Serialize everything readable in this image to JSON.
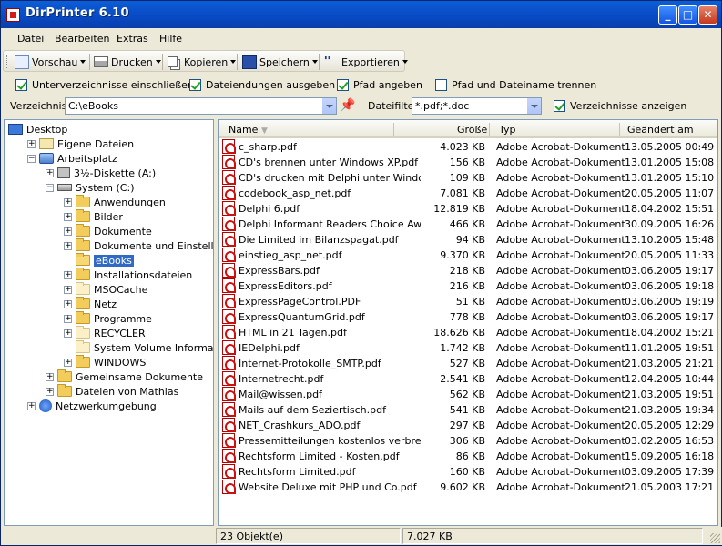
{
  "window": {
    "title": "DirPrinter 6.10",
    "min": "_",
    "max": "□",
    "close": "✕"
  },
  "menu": [
    "Datei",
    "Bearbeiten",
    "Extras",
    "Hilfe"
  ],
  "toolbar": {
    "preview": "Vorschau",
    "print": "Drucken",
    "copy": "Kopieren",
    "save": "Speichern",
    "export": "Exportieren"
  },
  "options": {
    "include_subdirs": {
      "label": "Unterverzeichnisse einschließen",
      "checked": true
    },
    "show_extensions": {
      "label": "Dateiendungen ausgeben",
      "checked": true
    },
    "show_path": {
      "label": "Pfad angeben",
      "checked": true
    },
    "split_path": {
      "label": "Pfad und Dateiname trennen",
      "checked": false
    },
    "show_dirs": {
      "label": "Verzeichnisse anzeigen",
      "checked": true
    }
  },
  "directory": {
    "label": "Verzeichnis",
    "value": "C:\\eBooks"
  },
  "filter": {
    "label": "Dateifilter",
    "value": "*.pdf;*.doc"
  },
  "tree": [
    {
      "label": "Desktop",
      "level": 0,
      "icon": "desktop-icon",
      "box": ""
    },
    {
      "label": "Eigene Dateien",
      "level": 1,
      "icon": "my-documents-icon",
      "box": "+"
    },
    {
      "label": "Arbeitsplatz",
      "level": 1,
      "icon": "my-computer-icon",
      "box": "−"
    },
    {
      "label": "3½-Diskette (A:)",
      "level": 2,
      "icon": "floppy-icon",
      "box": "+"
    },
    {
      "label": "System (C:)",
      "level": 2,
      "icon": "drive-icon",
      "box": "−"
    },
    {
      "label": "Anwendungen",
      "level": 3,
      "icon": "folder-icon",
      "box": "+"
    },
    {
      "label": "Bilder",
      "level": 3,
      "icon": "folder-icon",
      "box": "+"
    },
    {
      "label": "Dokumente",
      "level": 3,
      "icon": "folder-icon",
      "box": "+"
    },
    {
      "label": "Dokumente und Einstellungen",
      "level": 3,
      "icon": "folder-icon",
      "box": "+"
    },
    {
      "label": "eBooks",
      "level": 3,
      "icon": "folder-open-icon",
      "box": "",
      "selected": true
    },
    {
      "label": "Installationsdateien",
      "level": 3,
      "icon": "folder-icon",
      "box": "+"
    },
    {
      "label": "MSOCache",
      "level": 3,
      "icon": "folder-pale-icon",
      "box": "+"
    },
    {
      "label": "Netz",
      "level": 3,
      "icon": "folder-icon",
      "box": "+"
    },
    {
      "label": "Programme",
      "level": 3,
      "icon": "folder-icon",
      "box": "+"
    },
    {
      "label": "RECYCLER",
      "level": 3,
      "icon": "folder-pale-icon",
      "box": "+"
    },
    {
      "label": "System Volume Information",
      "level": 3,
      "icon": "folder-pale-icon",
      "box": ""
    },
    {
      "label": "WINDOWS",
      "level": 3,
      "icon": "folder-icon",
      "box": "+"
    },
    {
      "label": "Gemeinsame Dokumente",
      "level": 2,
      "icon": "folder-icon",
      "box": "+"
    },
    {
      "label": "Dateien von Mathias",
      "level": 2,
      "icon": "folder-icon",
      "box": "+"
    },
    {
      "label": "Netzwerkumgebung",
      "level": 1,
      "icon": "network-icon",
      "box": "+"
    }
  ],
  "list": {
    "columns": [
      "Name",
      "Größe",
      "Typ",
      "Geändert am"
    ],
    "rows": [
      [
        "c_sharp.pdf",
        "4.023 KB",
        "Adobe Acrobat-Dokument",
        "13.05.2005 00:49"
      ],
      [
        "CD's brennen unter Windows XP.pdf",
        "156 KB",
        "Adobe Acrobat-Dokument",
        "13.01.2005 15:08"
      ],
      [
        "CD's drucken mit Delphi unter Windo...",
        "109 KB",
        "Adobe Acrobat-Dokument",
        "13.01.2005 15:10"
      ],
      [
        "codebook_asp_net.pdf",
        "7.081 KB",
        "Adobe Acrobat-Dokument",
        "20.05.2005 11:07"
      ],
      [
        "Delphi 6.pdf",
        "12.819 KB",
        "Adobe Acrobat-Dokument",
        "18.04.2002 15:51"
      ],
      [
        "Delphi Informant Readers Choice Aw...",
        "466 KB",
        "Adobe Acrobat-Dokument",
        "30.09.2005 16:26"
      ],
      [
        "Die Limited im Bilanzspagat.pdf",
        "94 KB",
        "Adobe Acrobat-Dokument",
        "13.10.2005 15:48"
      ],
      [
        "einstieg_asp_net.pdf",
        "9.370 KB",
        "Adobe Acrobat-Dokument",
        "20.05.2005 11:33"
      ],
      [
        "ExpressBars.pdf",
        "218 KB",
        "Adobe Acrobat-Dokument",
        "03.06.2005 19:17"
      ],
      [
        "ExpressEditors.pdf",
        "216 KB",
        "Adobe Acrobat-Dokument",
        "03.06.2005 19:18"
      ],
      [
        "ExpressPageControl.PDF",
        "51 KB",
        "Adobe Acrobat-Dokument",
        "03.06.2005 19:19"
      ],
      [
        "ExpressQuantumGrid.pdf",
        "778 KB",
        "Adobe Acrobat-Dokument",
        "03.06.2005 19:17"
      ],
      [
        "HTML in 21 Tagen.pdf",
        "18.626 KB",
        "Adobe Acrobat-Dokument",
        "18.04.2002 15:21"
      ],
      [
        "IEDelphi.pdf",
        "1.742 KB",
        "Adobe Acrobat-Dokument",
        "11.01.2005 19:51"
      ],
      [
        "Internet-Protokolle_SMTP.pdf",
        "527 KB",
        "Adobe Acrobat-Dokument",
        "21.03.2005 21:21"
      ],
      [
        "Internetrecht.pdf",
        "2.541 KB",
        "Adobe Acrobat-Dokument",
        "12.04.2005 10:44"
      ],
      [
        "Mail@wissen.pdf",
        "562 KB",
        "Adobe Acrobat-Dokument",
        "21.03.2005 19:51"
      ],
      [
        "Mails auf dem Seziertisch.pdf",
        "541 KB",
        "Adobe Acrobat-Dokument",
        "21.03.2005 19:34"
      ],
      [
        "NET_Crashkurs_ADO.pdf",
        "297 KB",
        "Adobe Acrobat-Dokument",
        "20.05.2005 12:29"
      ],
      [
        "Pressemitteilungen kostenlos verbreit...",
        "306 KB",
        "Adobe Acrobat-Dokument",
        "03.02.2005 16:53"
      ],
      [
        "Rechtsform Limited - Kosten.pdf",
        "86 KB",
        "Adobe Acrobat-Dokument",
        "15.09.2005 16:18"
      ],
      [
        "Rechtsform Limited.pdf",
        "160 KB",
        "Adobe Acrobat-Dokument",
        "03.09.2005 17:39"
      ],
      [
        "Website Deluxe mit PHP und Co.pdf",
        "9.602 KB",
        "Adobe Acrobat-Dokument",
        "21.05.2003 17:21"
      ]
    ]
  },
  "status": {
    "count": "23 Objekt(e)",
    "size": "7.027 KB"
  },
  "colors": {
    "titlebar": "#0a4fc8",
    "selection": "#316ac5",
    "pdf_red": "#cc1010"
  }
}
